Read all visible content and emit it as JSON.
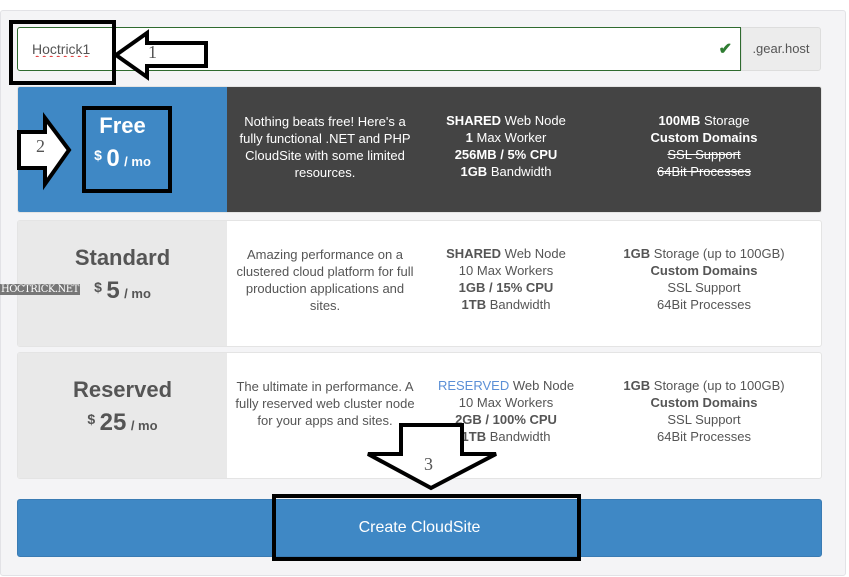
{
  "subdomain": {
    "value": "Hoctrick1",
    "suffix": ".gear.host",
    "valid_icon": "check-icon",
    "valid_color": "#2f7d32"
  },
  "plans": [
    {
      "name": "Free",
      "currency": "$",
      "amount": "0",
      "period": "/ mo",
      "selected": true,
      "description": "Nothing beats free! Here's a fully functional .NET and PHP CloudSite with some limited resources.",
      "node_bold": "SHARED",
      "node": " Web Node",
      "workers_bold": "1",
      "workers": " Max Worker",
      "cpu": "256MB / 5% CPU",
      "bw_bold": "1GB",
      "bw": " Bandwidth",
      "storage_bold": "100MB",
      "storage": " Storage",
      "domains": "Custom Domains",
      "ssl": "SSL Support",
      "bit64": "64Bit Processes"
    },
    {
      "name": "Standard",
      "currency": "$",
      "amount": "5",
      "period": "/ mo",
      "selected": false,
      "description": "Amazing performance on a clustered cloud platform for full production applications and sites.",
      "node_bold": "SHARED",
      "node": " Web Node",
      "workers_bold": "",
      "workers": "10 Max Workers",
      "cpu": "1GB / 15% CPU",
      "bw_bold": "1TB",
      "bw": " Bandwidth",
      "storage_bold": "1GB",
      "storage": " Storage (up to 100GB)",
      "domains": "Custom Domains",
      "ssl": "SSL Support",
      "bit64": "64Bit Processes"
    },
    {
      "name": "Reserved",
      "currency": "$",
      "amount": "25",
      "period": "/ mo",
      "selected": false,
      "description": "The ultimate in performance. A fully reserved web cluster node for your apps and sites.",
      "node_bold": "RESERVED",
      "node": " Web Node",
      "workers_bold": "",
      "workers": "10 Max Workers",
      "cpu": "2GB / 100% CPU",
      "bw_bold": "1TB",
      "bw": " Bandwidth",
      "storage_bold": "1GB",
      "storage": " Storage (up to 100GB)",
      "domains": "Custom Domains",
      "ssl": "SSL Support",
      "bit64": "64Bit Processes"
    }
  ],
  "create_button": "Create CloudSite",
  "annotations": {
    "step1": "1",
    "step2": "2",
    "step3": "3",
    "watermark": "HOCTRICK.NET"
  },
  "colors": {
    "accent": "#3f88c5",
    "selected_body": "#444444",
    "reserved_text": "#5b8fd6"
  }
}
